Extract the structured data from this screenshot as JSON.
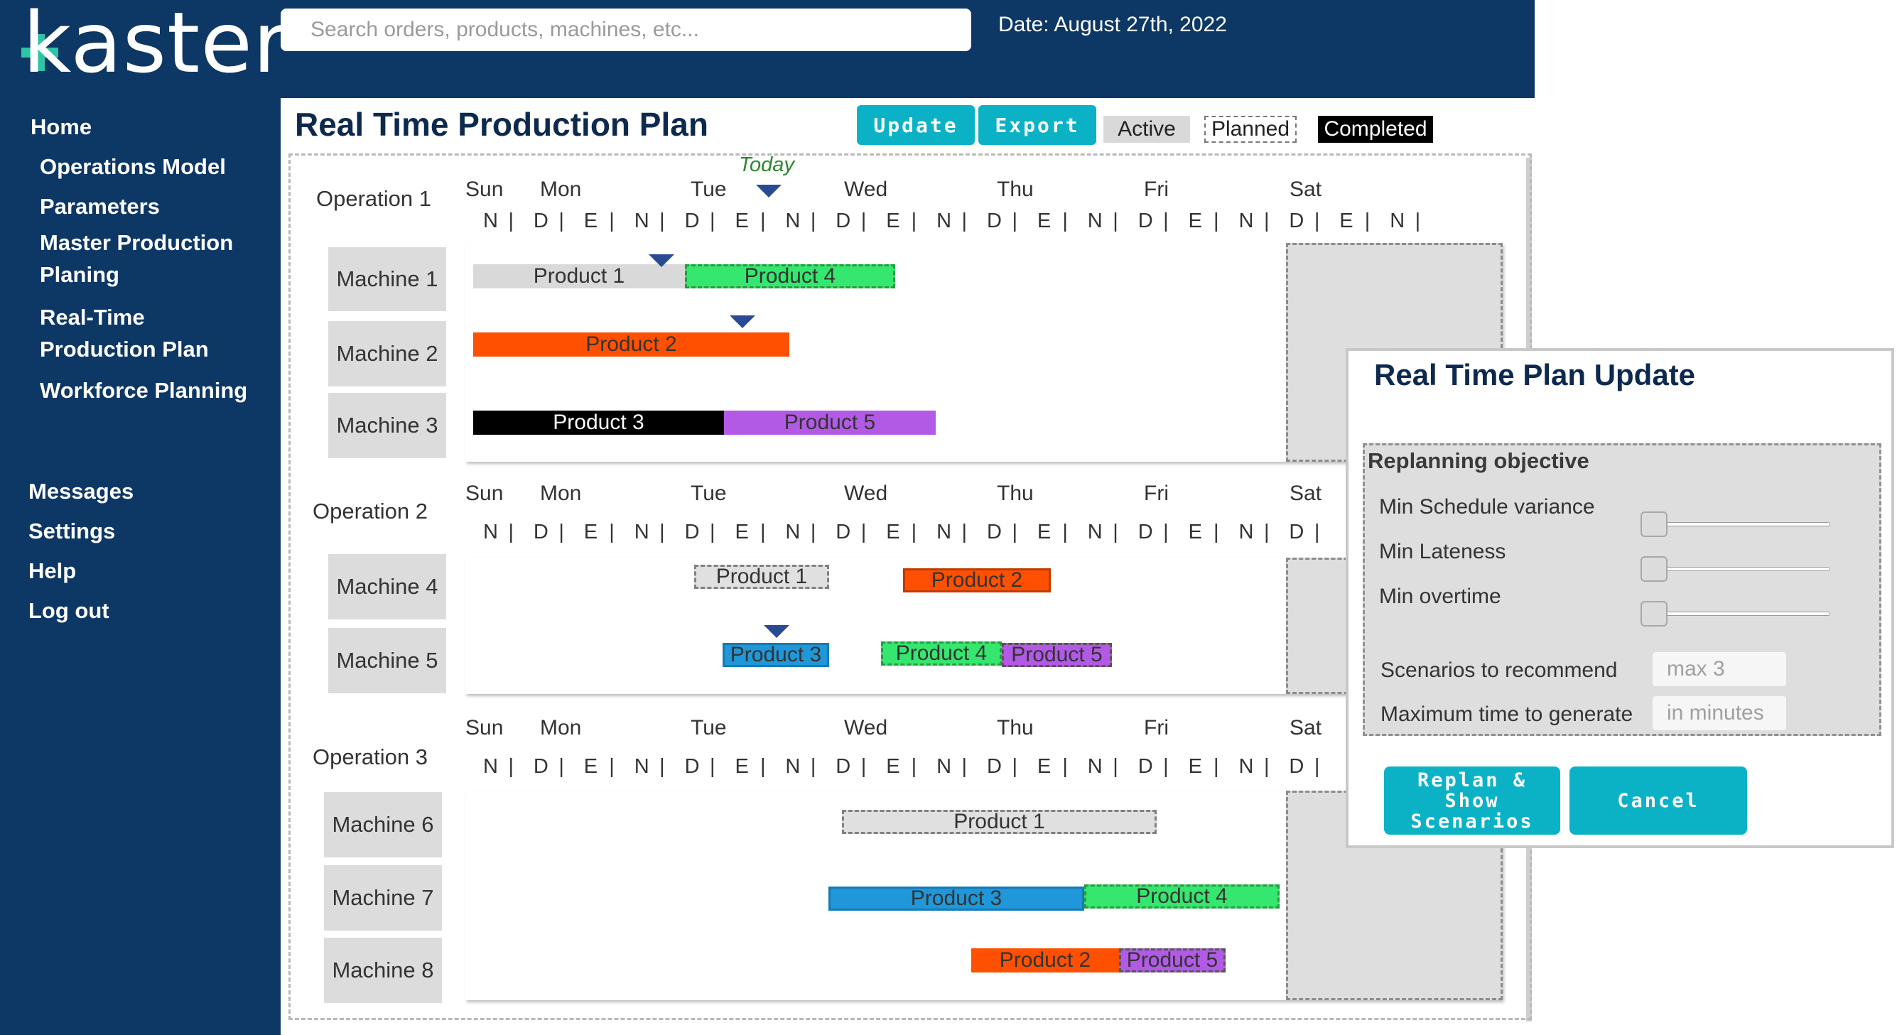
{
  "brand": {
    "name": "kaster"
  },
  "search": {
    "placeholder": "Search orders, products, machines, etc..."
  },
  "date_label": "Date: August 27th, 2022",
  "sidebar": {
    "home": "Home",
    "operations_model": "Operations Model",
    "parameters": "Parameters",
    "master_line1": "Master Production",
    "master_line2": "Planing",
    "realtime_line1": "Real-Time",
    "realtime_line2": "Production Plan",
    "workforce": "Workforce Planning",
    "messages": "Messages",
    "settings": "Settings",
    "help": "Help",
    "logout": "Log out"
  },
  "page": {
    "title": "Real Time Production Plan",
    "update_label": "Update",
    "export_label": "Export",
    "legend_active": "Active",
    "legend_planned": "Planned",
    "legend_completed": "Completed",
    "today_label": "Today"
  },
  "days": [
    "Sun",
    "Mon",
    "Tue",
    "Wed",
    "Thu",
    "Fri",
    "Sat"
  ],
  "shift_codes": [
    "N",
    "|",
    "D",
    "|",
    "E",
    "|",
    "N",
    "|",
    "D",
    "|",
    "E",
    "|",
    "N",
    "|",
    "D",
    "|",
    "E",
    "|",
    "N",
    "|",
    "D",
    "|",
    "E",
    "|",
    "N",
    "|",
    "D",
    "|",
    "E",
    "|",
    "N",
    "|",
    "D",
    "|",
    "E",
    "|",
    "N",
    "|"
  ],
  "operations": [
    {
      "label": "Operation 1",
      "machines": [
        "Machine 1",
        "Machine 2",
        "Machine 3"
      ],
      "bars": [
        [
          "Product 1",
          "Product 4"
        ],
        [
          "Product 2"
        ],
        [
          "Product 3",
          "Product 5"
        ]
      ]
    },
    {
      "label": "Operation 2",
      "machines": [
        "Machine 4",
        "Machine 5"
      ],
      "bars": [
        [
          "Product 1",
          "Product 2"
        ],
        [
          "Product 3",
          "Product 4",
          "Product 5"
        ]
      ]
    },
    {
      "label": "Operation 3",
      "machines": [
        "Machine 6",
        "Machine 7",
        "Machine 8"
      ],
      "bars": [
        [
          "Product 1"
        ],
        [
          "Product 3",
          "Product 4"
        ],
        [
          "Product 2",
          "Product 5"
        ]
      ]
    }
  ],
  "popup": {
    "title": "Real Time Plan Update",
    "objective_heading": "Replanning objective",
    "objectives": [
      "Min Schedule variance",
      "Min Lateness",
      "Min overtime"
    ],
    "scenarios_label": "Scenarios to recommend",
    "scenarios_placeholder": "max 3",
    "max_time_label": "Maximum time to generate",
    "max_time_placeholder": "in minutes",
    "replan_line1": "Replan & Show",
    "replan_line2": "Scenarios",
    "cancel_label": "Cancel"
  },
  "colors": {
    "navy": "#0d3764",
    "teal": "#0bb2c6",
    "orange": "#fe5000",
    "green": "#35e76e",
    "purple": "#b25ae6",
    "blue": "#1f97d8",
    "marker": "#2b4a94"
  }
}
